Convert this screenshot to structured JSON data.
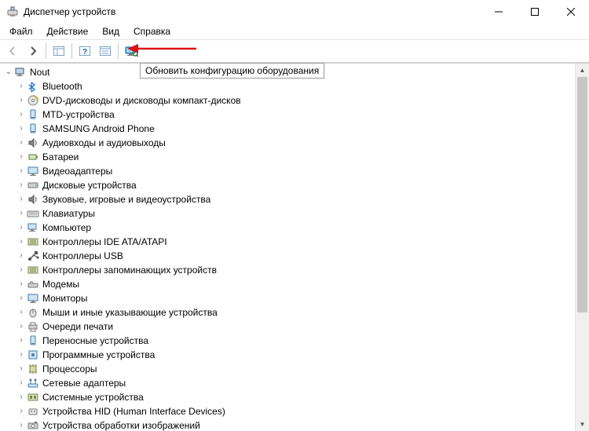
{
  "window": {
    "title": "Диспетчер устройств"
  },
  "menu": {
    "file": "Файл",
    "action": "Действие",
    "view": "Вид",
    "help": "Справка"
  },
  "tooltip": {
    "scan_hardware": "Обновить конфигурацию оборудования"
  },
  "tree": {
    "root": "Nout",
    "items": [
      {
        "label": "Bluetooth",
        "icon": "bluetooth"
      },
      {
        "label": "DVD-дисководы и дисководы компакт-дисков",
        "icon": "dvd"
      },
      {
        "label": "MTD-устройства",
        "icon": "mtd"
      },
      {
        "label": "SAMSUNG Android Phone",
        "icon": "phone"
      },
      {
        "label": "Аудиовходы и аудиовыходы",
        "icon": "audio"
      },
      {
        "label": "Батареи",
        "icon": "battery"
      },
      {
        "label": "Видеоадаптеры",
        "icon": "display"
      },
      {
        "label": "Дисковые устройства",
        "icon": "disk"
      },
      {
        "label": "Звуковые, игровые и видеоустройства",
        "icon": "sound"
      },
      {
        "label": "Клавиатуры",
        "icon": "keyboard"
      },
      {
        "label": "Компьютер",
        "icon": "computer"
      },
      {
        "label": "Контроллеры IDE ATA/ATAPI",
        "icon": "ide"
      },
      {
        "label": "Контроллеры USB",
        "icon": "usb"
      },
      {
        "label": "Контроллеры запоминающих устройств",
        "icon": "storagectl"
      },
      {
        "label": "Модемы",
        "icon": "modem"
      },
      {
        "label": "Мониторы",
        "icon": "monitor"
      },
      {
        "label": "Мыши и иные указывающие устройства",
        "icon": "mouse"
      },
      {
        "label": "Очереди печати",
        "icon": "printer"
      },
      {
        "label": "Переносные устройства",
        "icon": "portable"
      },
      {
        "label": "Программные устройства",
        "icon": "software"
      },
      {
        "label": "Процессоры",
        "icon": "cpu"
      },
      {
        "label": "Сетевые адаптеры",
        "icon": "network"
      },
      {
        "label": "Системные устройства",
        "icon": "system"
      },
      {
        "label": "Устройства HID (Human Interface Devices)",
        "icon": "hid"
      },
      {
        "label": "Устройства обработки изображений",
        "icon": "imaging"
      }
    ]
  }
}
